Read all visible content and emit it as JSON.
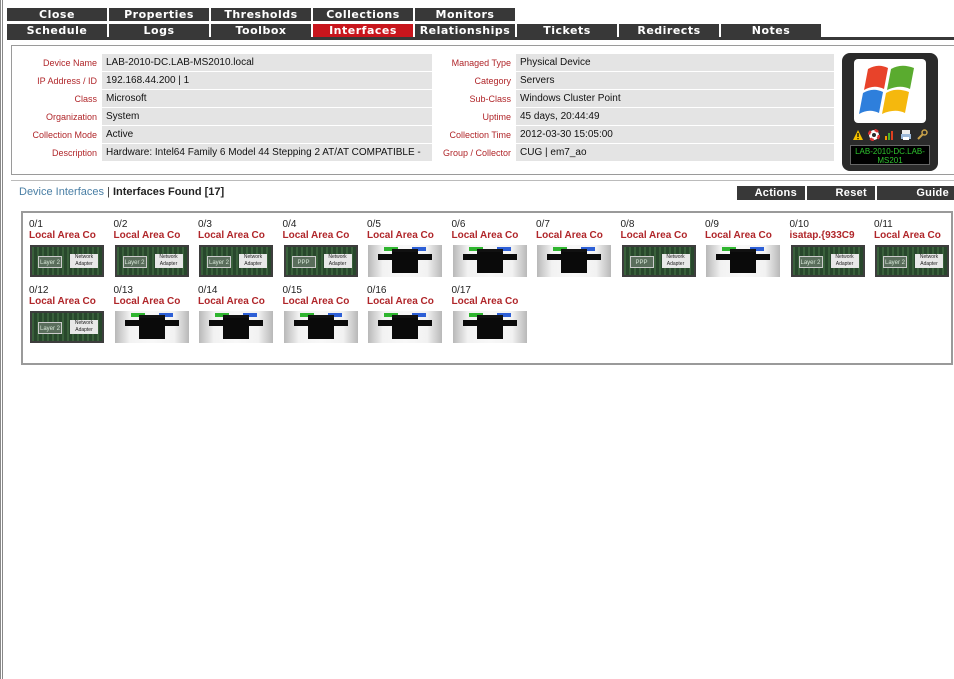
{
  "tabs_row1": [
    {
      "label": "Close",
      "active": false
    },
    {
      "label": "Properties",
      "active": false
    },
    {
      "label": "Thresholds",
      "active": false
    },
    {
      "label": "Collections",
      "active": false
    },
    {
      "label": "Monitors",
      "active": false
    }
  ],
  "tabs_row2": [
    {
      "label": "Schedule",
      "active": false
    },
    {
      "label": "Logs",
      "active": false
    },
    {
      "label": "Toolbox",
      "active": false
    },
    {
      "label": "Interfaces",
      "active": true
    },
    {
      "label": "Relationships",
      "active": false
    },
    {
      "label": "Tickets",
      "active": false
    },
    {
      "label": "Redirects",
      "active": false
    },
    {
      "label": "Notes",
      "active": false
    }
  ],
  "device": {
    "left": [
      {
        "label": "Device Name",
        "value": "LAB-2010-DC.LAB-MS2010.local"
      },
      {
        "label": "IP Address / ID",
        "value": "192.168.44.200 | 1"
      },
      {
        "label": "Class",
        "value": "Microsoft"
      },
      {
        "label": "Organization",
        "value": "System"
      },
      {
        "label": "Collection Mode",
        "value": "Active"
      },
      {
        "label": "Description",
        "value": "Hardware: Intel64 Family 6 Model 44 Stepping 2 AT/AT COMPATIBLE -"
      }
    ],
    "right": [
      {
        "label": "Managed Type",
        "value": "Physical Device"
      },
      {
        "label": "Category",
        "value": "Servers"
      },
      {
        "label": "Sub-Class",
        "value": "Windows Cluster Point"
      },
      {
        "label": "Uptime",
        "value": "45 days, 20:44:49"
      },
      {
        "label": "Collection Time",
        "value": "2012-03-30 15:05:00"
      },
      {
        "label": "Group / Collector",
        "value": "CUG | em7_ao"
      }
    ],
    "icon_name": "windows-logo-icon",
    "name_badge": "LAB-2010-DC.LAB-MS201",
    "status_icons": [
      "warning-icon",
      "lifebuoy-icon",
      "bar-chart-icon",
      "print-icon",
      "wrench-icon"
    ]
  },
  "interfaces_header": {
    "link": "Device Interfaces",
    "separator": " | ",
    "found": "Interfaces Found [17]",
    "buttons": {
      "actions": "Actions",
      "reset": "Reset",
      "guide": "Guide"
    }
  },
  "interfaces": [
    {
      "id": "0/1",
      "name": "Local Area Co",
      "kind": "chip"
    },
    {
      "id": "0/2",
      "name": "Local Area Co",
      "kind": "chip"
    },
    {
      "id": "0/3",
      "name": "Local Area Co",
      "kind": "chip"
    },
    {
      "id": "0/4",
      "name": "Local Area Co",
      "kind": "chip-ppp"
    },
    {
      "id": "0/5",
      "name": "Local Area Co",
      "kind": "port"
    },
    {
      "id": "0/6",
      "name": "Local Area Co",
      "kind": "port"
    },
    {
      "id": "0/7",
      "name": "Local Area Co",
      "kind": "port"
    },
    {
      "id": "0/8",
      "name": "Local Area Co",
      "kind": "chip-ppp"
    },
    {
      "id": "0/9",
      "name": "Local Area Co",
      "kind": "port"
    },
    {
      "id": "0/10",
      "name": "isatap.{933C9",
      "kind": "chip"
    },
    {
      "id": "0/11",
      "name": "Local Area Co",
      "kind": "chip"
    },
    {
      "id": "0/12",
      "name": "Local Area Co",
      "kind": "chip"
    },
    {
      "id": "0/13",
      "name": "Local Area Co",
      "kind": "port"
    },
    {
      "id": "0/14",
      "name": "Local Area Co",
      "kind": "port"
    },
    {
      "id": "0/15",
      "name": "Local Area Co",
      "kind": "port"
    },
    {
      "id": "0/16",
      "name": "Local Area Co",
      "kind": "port"
    },
    {
      "id": "0/17",
      "name": "Local Area Co",
      "kind": "port"
    }
  ],
  "colors": {
    "tab_bg": "#383838",
    "tab_active": "#c8161d",
    "label_red": "#b0262a",
    "link_blue": "#4a7fa5"
  }
}
